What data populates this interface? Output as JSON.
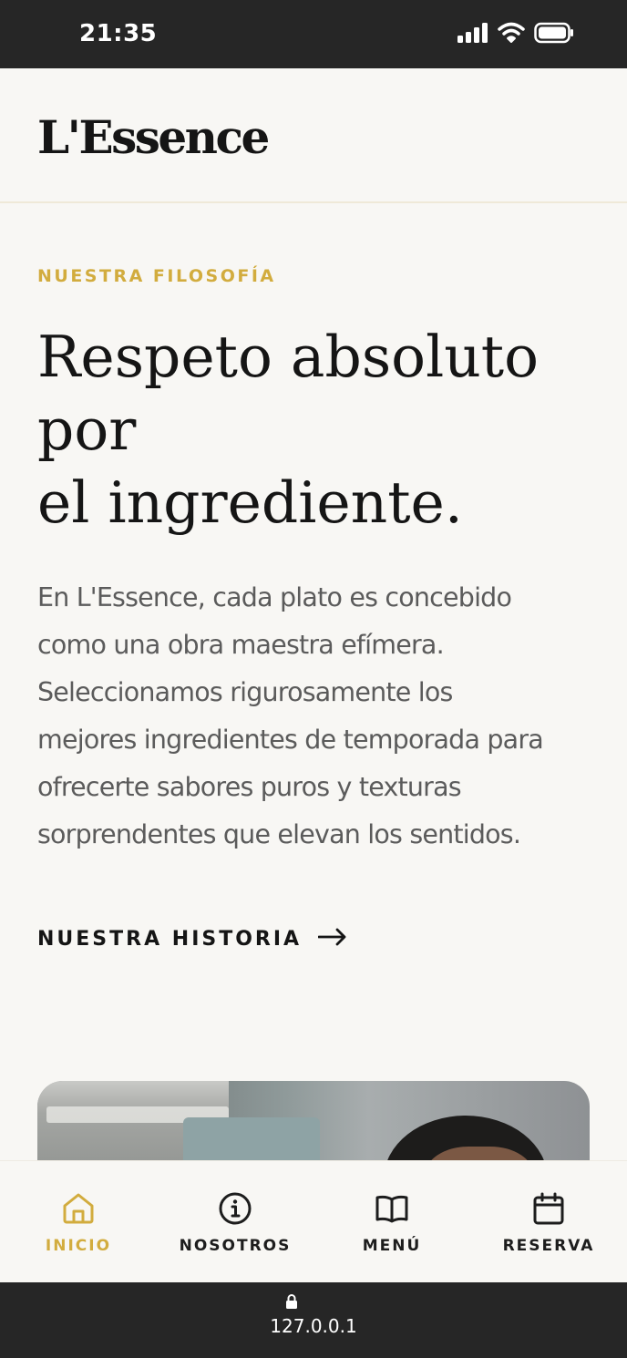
{
  "status_bar": {
    "time": "21:35",
    "icons": [
      "signal-icon",
      "wifi-icon",
      "battery-icon"
    ]
  },
  "header": {
    "logo": "L'Essence"
  },
  "philosophy": {
    "eyebrow": "NUESTRA FILOSOFÍA",
    "title_lines": [
      "Respeto absoluto",
      "por",
      "el ingrediente."
    ],
    "body_lines": [
      "En L'Essence, cada plato es concebido",
      "como una obra maestra efímera.",
      "Seleccionamos rigurosamente los",
      "mejores ingredientes de temporada para",
      "ofrecerte sabores puros y texturas",
      "sorprendentes que elevan los sentidos."
    ],
    "cta_label": "NUESTRA HISTORIA",
    "cta_icon": "arrow-right-icon"
  },
  "bottom_nav": {
    "items": [
      {
        "label": "INICIO",
        "icon": "home-icon",
        "active": true
      },
      {
        "label": "NOSOTROS",
        "icon": "info-icon",
        "active": false
      },
      {
        "label": "MENÚ",
        "icon": "book-icon",
        "active": false
      },
      {
        "label": "RESERVA",
        "icon": "calendar-icon",
        "active": false
      }
    ]
  },
  "browser": {
    "url": "127.0.0.1",
    "icon": "lock-icon"
  },
  "colors": {
    "accent": "#d2ac3e",
    "text_dark": "#151515",
    "text_body": "#5b5b5b",
    "background": "#f8f7f4",
    "system_bar": "#262626"
  }
}
